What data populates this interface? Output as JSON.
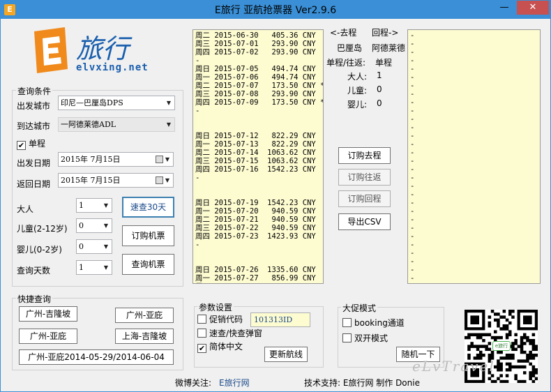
{
  "window": {
    "title": "E旅行 亚航抢票器  Ver2.9.6",
    "icon": "e-travel-app-icon"
  },
  "titlebar_buttons": {
    "minimize": "—",
    "close": "✕"
  },
  "logo": {
    "brand": "旅行",
    "url_text": "elvxing.net"
  },
  "query": {
    "group_label": "查询条件",
    "depart_city_label": "出发城市",
    "depart_city_value": "印尼—巴厘岛DPS",
    "arrive_city_label": "到达城市",
    "arrive_city_value": "一阿德莱德ADL",
    "oneway_label": "单程",
    "oneway_checked": "✔",
    "depart_date_label": "出发日期",
    "depart_date_value": "2015年  7月15日",
    "return_date_label": "返回日期",
    "return_date_value": "2015年  7月15日",
    "adult_label": "大人",
    "adult_value": "1",
    "child_label": "儿童(2-12岁)",
    "child_value": "0",
    "infant_label": "婴儿(0-2岁)",
    "infant_value": "0",
    "days_label": "查询天数",
    "days_value": "1"
  },
  "buttons": {
    "quick30": "速查30天",
    "book_ticket": "订购机票",
    "search_ticket": "查询机票",
    "book_outbound": "订购去程",
    "book_roundtrip": "订购往返",
    "book_return": "订购回程",
    "export_csv": "导出CSV",
    "update_route": "更新航线",
    "random": "随机一下"
  },
  "shortcuts": {
    "group_label": "快捷查询",
    "items": [
      "广州-吉隆坡",
      "广州-亚庇",
      "广州-亚庇",
      "上海-吉隆坡",
      "广州-亚庇2014-05-29/2014-06-04"
    ]
  },
  "results_rows": [
    "周二 2015-06-30   405.36 CNY",
    "周三 2015-07-01   293.90 CNY",
    "周四 2015-07-02   293.90 CNY",
    "-",
    "周日 2015-07-05   494.74 CNY",
    "周一 2015-07-06   494.74 CNY",
    "周二 2015-07-07   173.50 CNY *",
    "周三 2015-07-08   293.90 CNY",
    "周四 2015-07-09   173.50 CNY *",
    "-",
    "",
    "",
    "周日 2015-07-12   822.29 CNY",
    "周一 2015-07-13   822.29 CNY",
    "周二 2015-07-14  1063.62 CNY",
    "周三 2015-07-15  1063.62 CNY",
    "周四 2015-07-16  1542.23 CNY",
    "-",
    "",
    "",
    "周日 2015-07-19  1542.23 CNY",
    "周一 2015-07-20   940.59 CNY",
    "周二 2015-07-21   940.59 CNY",
    "周三 2015-07-22   940.59 CNY",
    "周四 2015-07-23  1423.93 CNY",
    "-",
    "",
    "",
    "周日 2015-07-26  1335.60 CNY",
    "周一 2015-07-27   856.99 CNY",
    "周二 2015-07-28   173.50 CNY *",
    "周三 2015-07-29   173.50 CNY *"
  ],
  "summary": {
    "outbound_header": "<-去程",
    "return_header": "回程->",
    "from": "巴厘岛",
    "to": "阿德莱德",
    "trip_label": "单程/往返:",
    "trip_value": "单程",
    "adult_label": "大人:",
    "adult_value": "1",
    "child_label": "儿童:",
    "child_value": "0",
    "infant_label": "婴儿:",
    "infant_value": "0"
  },
  "return_results_rows": [
    "-",
    "-",
    "-",
    "-",
    "-",
    "-",
    "-",
    "-",
    "-",
    "-",
    "-",
    "-",
    "-",
    "-",
    "-",
    "-",
    "-",
    "-",
    "-",
    "-",
    "-",
    "-",
    "-",
    "-",
    "-",
    "-",
    "-",
    "-",
    "-",
    "-",
    "-"
  ],
  "params": {
    "group_label": "参数设置",
    "promo_label": "促销代码",
    "promo_value": "101313ID",
    "popup_label": "速查/快查弹窗",
    "simplified_label": "简体中文",
    "simplified_checked": "✔"
  },
  "promo_mode": {
    "group_label": "大促模式",
    "booking_channel": "booking通道",
    "dual_mode": "双开模式"
  },
  "footer": {
    "weibo_label": "微博关注:",
    "weibo_link": "E旅行网",
    "support_text": "技术支持: E旅行网 制作 Donie"
  },
  "qr_label": "e旅行",
  "watermark": "eLvTravel"
}
